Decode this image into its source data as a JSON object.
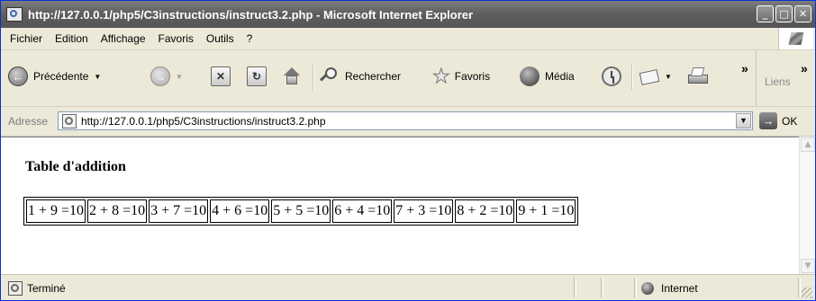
{
  "window": {
    "title": "http://127.0.0.1/php5/C3instructions/instruct3.2.php - Microsoft Internet Explorer",
    "controls": {
      "minimize": "_",
      "maximize": "□",
      "close": "✕"
    }
  },
  "menu": [
    "Fichier",
    "Edition",
    "Affichage",
    "Favoris",
    "Outils",
    "?"
  ],
  "toolbar": {
    "back_label": "Précédente",
    "search_label": "Rechercher",
    "favorites_label": "Favoris",
    "media_label": "Média",
    "chevron": "»",
    "links_label": "Liens"
  },
  "address": {
    "label": "Adresse",
    "url": "http://127.0.0.1/php5/C3instructions/instruct3.2.php",
    "go_label": "OK"
  },
  "page": {
    "heading": "Table d'addition",
    "cells": [
      "1 + 9 =10",
      "2 + 8 =10",
      "3 + 7 =10",
      "4 + 6 =10",
      "5 + 5 =10",
      "6 + 4 =10",
      "7 + 3 =10",
      "8 + 2 =10",
      "9 + 1 =10"
    ]
  },
  "status": {
    "text": "Terminé",
    "zone": "Internet"
  }
}
